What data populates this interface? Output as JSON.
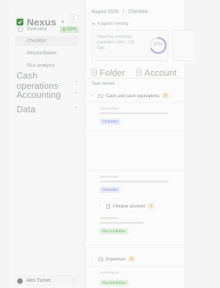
{
  "sidebar": {
    "brand": "Nexus",
    "nav": [
      {
        "label": "Overview",
        "badge": "62%"
      },
      {
        "label": "Checklist"
      },
      {
        "label": "Reconciliation"
      },
      {
        "label": "Flux analysis"
      }
    ],
    "sections": [
      "Cash operations",
      "Accounting",
      "Data"
    ],
    "user": "Alex Turner"
  },
  "main": {
    "breadcrumb": [
      "August 2025",
      "/",
      "Checklist"
    ],
    "agents_status": "6 agents running",
    "match_card": {
      "text": "Matching customer payments 1180 - US Ops",
      "percent": "67%",
      "progress": 0.67
    },
    "tabs": [
      "Folder",
      "Account"
    ],
    "tasks_label": "Task details",
    "groups": [
      {
        "name": "Cash and cash equivalents",
        "count": "3"
      },
      {
        "name": "Cheque account",
        "count": "1"
      },
      {
        "name": "Expenses",
        "count": "4"
      }
    ],
    "tags": {
      "checklist": "Checklist",
      "reconciliation": "Reconciliation"
    }
  },
  "colors": {
    "accent": "#3e9a4a",
    "badge_green": "#6bb06b",
    "count_orange": "#d7a25a",
    "checklist_blue": "#8a97e0"
  }
}
